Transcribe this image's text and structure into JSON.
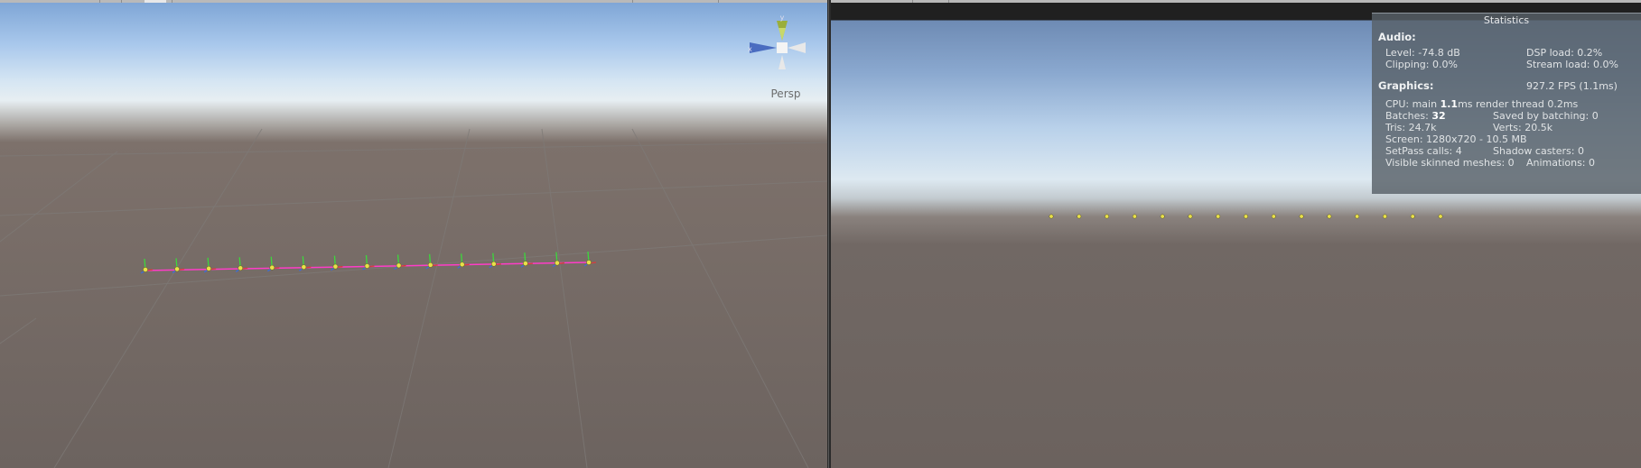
{
  "scene_view": {
    "camera_mode_label": "Persp",
    "gizmo_axes": {
      "y": "y",
      "x": "x"
    },
    "selected_objects": 15
  },
  "game_view": {
    "statistics": {
      "title": "Statistics",
      "audio_heading": "Audio:",
      "level_label": "Level: ",
      "level": "-74.8 dB",
      "dsp_label": "DSP load: ",
      "dsp": "0.2%",
      "clipping_label": "Clipping: ",
      "clipping": "0.0%",
      "stream_label": "Stream load: ",
      "stream": "0.0%",
      "graphics_heading": "Graphics:",
      "fps": "927.2 FPS (1.1ms)",
      "cpu_label": "CPU: main ",
      "cpu_main": "1.1",
      "cpu_unit": "ms  render thread 0.2ms",
      "batches_label": "Batches: ",
      "batches": "32",
      "saved_by_batching": "Saved by batching: 0",
      "tris": "Tris: 24.7k",
      "verts": "Verts: 20.5k",
      "screen": "Screen: 1280x720 - 10.5 MB",
      "setpass": "SetPass calls: 4",
      "shadow_casters": "Shadow casters: 0",
      "skinned": "Visible skinned meshes: 0",
      "animations": "Animations: 0"
    },
    "spheres_visible": 15
  },
  "colors": {
    "selection_line": "#ff3cc8",
    "sphere": "#e8e04a",
    "axis_y": "#3cd83c",
    "axis_x": "#d83c3c",
    "axis_z": "#3c6cd8"
  }
}
